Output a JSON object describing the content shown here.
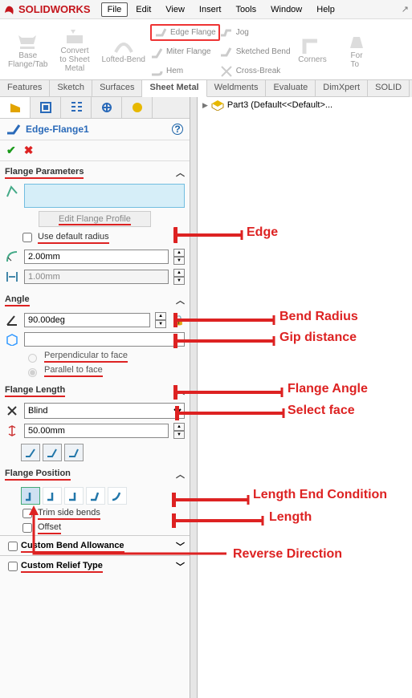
{
  "app": {
    "name": "SOLIDWORKS"
  },
  "menu": [
    "File",
    "Edit",
    "View",
    "Insert",
    "Tools",
    "Window",
    "Help"
  ],
  "ribbon": {
    "base": "Base\nFlange/Tab",
    "convert": "Convert\nto Sheet\nMetal",
    "lofted": "Lofted-Bend",
    "edge_flange": "Edge Flange",
    "miter": "Miter Flange",
    "hem": "Hem",
    "jog": "Jog",
    "sketched": "Sketched Bend",
    "cross": "Cross-Break",
    "corners": "Corners",
    "forming": "For\nTo"
  },
  "tabs": [
    "Features",
    "Sketch",
    "Surfaces",
    "Sheet Metal",
    "Weldments",
    "Evaluate",
    "DimXpert",
    "SOLID"
  ],
  "feature_mgr": {
    "title": "Edge-Flange1"
  },
  "crumbs": {
    "part": "Part3  (Default<<Default>..."
  },
  "panel": {
    "flange_params": {
      "title": "Flange Parameters",
      "edit_profile": "Edit Flange Profile",
      "use_default": "Use default radius",
      "radius": "2.00mm",
      "gap": "1.00mm"
    },
    "angle": {
      "title": "Angle",
      "value": "90.00deg",
      "perp": "Perpendicular to face",
      "para": "Parallel to face"
    },
    "length": {
      "title": "Flange Length",
      "end": "Blind",
      "value": "50.00mm"
    },
    "position": {
      "title": "Flange Position",
      "trim": "Trim side bends",
      "offset": "Offset"
    },
    "custom_bend": "Custom Bend Allowance",
    "custom_relief": "Custom Relief Type"
  },
  "anno": {
    "edge": "Edge",
    "bend_radius": "Bend Radius",
    "gap": "Gip distance",
    "flange_angle": "Flange Angle",
    "select_face": "Select face",
    "length_cond": "Length End Condition",
    "length": "Length",
    "reverse": "Reverse Direction"
  }
}
